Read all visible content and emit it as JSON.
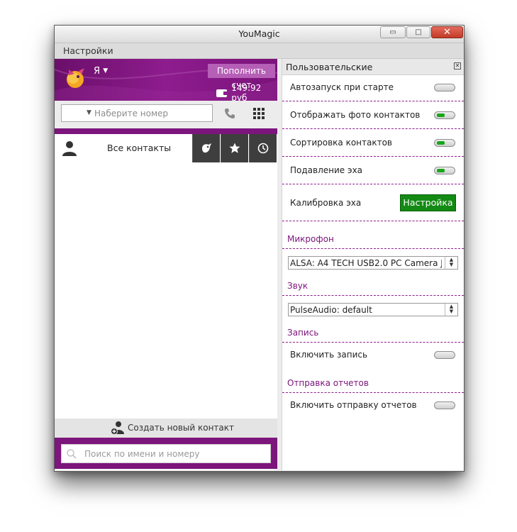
{
  "window": {
    "title": "YouMagic",
    "controls": {
      "minimize": "▭",
      "maximize": "□",
      "close": "✕"
    }
  },
  "menubar": {
    "settings": "Настройки"
  },
  "account": {
    "name": "Я",
    "topup_label": "Пополнить счет",
    "balance": "149.92 руб"
  },
  "dialer": {
    "placeholder": "Наберите номер"
  },
  "contacts": {
    "all_label": "Все контакты",
    "create_label": "Создать новый контакт",
    "search_placeholder": "Поиск по имени и номеру"
  },
  "settings_panel": {
    "title": "Пользовательские",
    "rows": [
      {
        "label": "Автозапуск при старте",
        "on": false
      },
      {
        "label": "Отображать фото контактов",
        "on": true
      },
      {
        "label": "Сортировка контактов",
        "on": true
      },
      {
        "label": "Подавление эха",
        "on": true
      }
    ],
    "calibration": {
      "label": "Калибровка эха",
      "button": "Настройка"
    },
    "microphone": {
      "title": "Микрофон",
      "value": "ALSA: A4 TECH USB2.0 PC Camera J"
    },
    "sound": {
      "title": "Звук",
      "value": "PulseAudio: default"
    },
    "recording": {
      "title": "Запись",
      "row_label": "Включить запись",
      "on": false
    },
    "reports": {
      "title": "Отправка отчетов",
      "row_label": "Включить отправку отчетов",
      "on": false
    }
  },
  "colors": {
    "brand_purple": "#7c157c",
    "accent_green": "#138a13",
    "toggle_on": "#1aa51a"
  }
}
